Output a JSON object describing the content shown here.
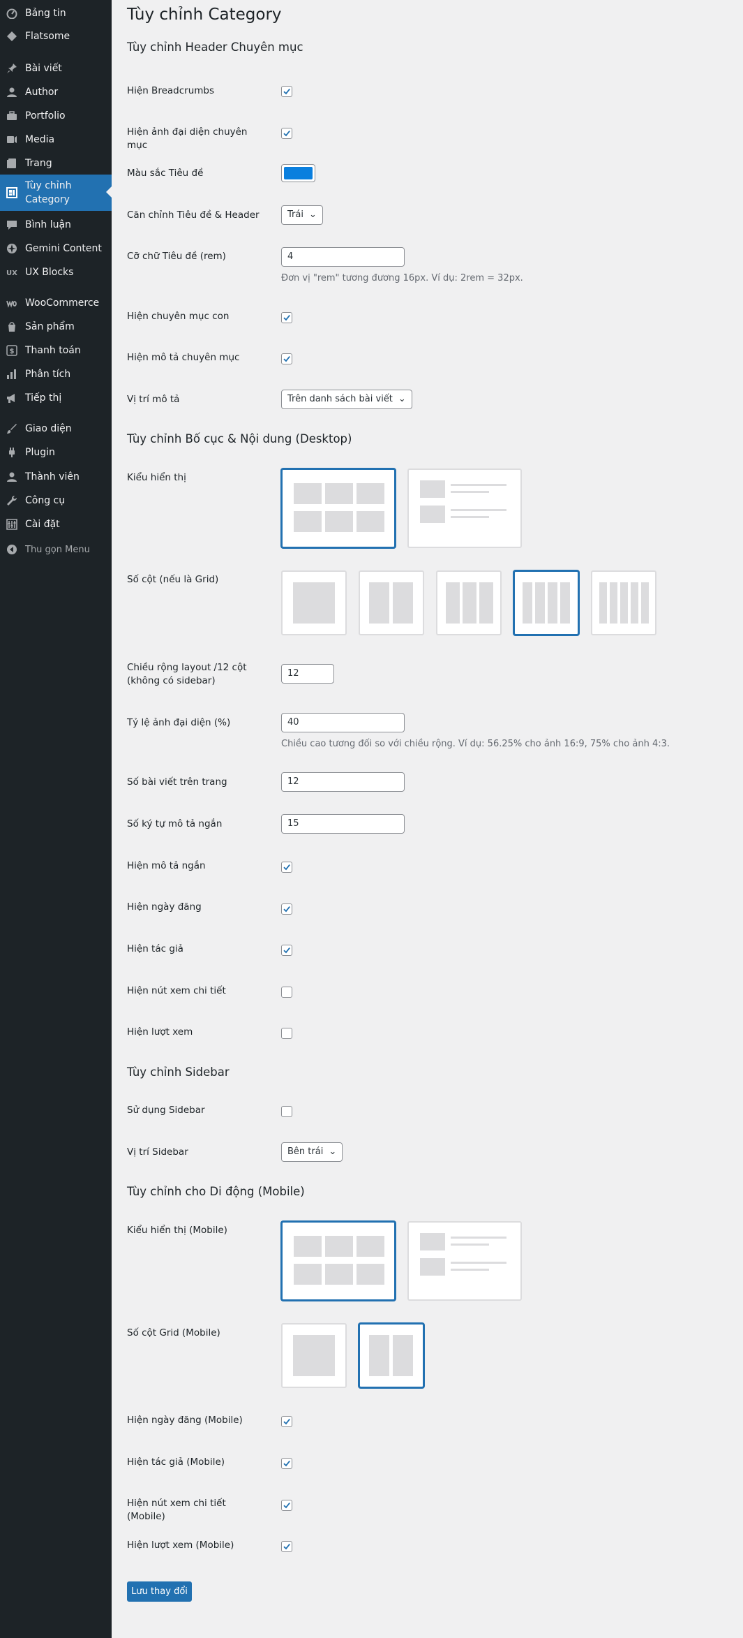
{
  "menu": [
    {
      "label": "Bảng tin",
      "icon": "dashboard-icon"
    },
    {
      "label": "Flatsome",
      "icon": "flatsome-icon"
    },
    {
      "label": "Bài viết",
      "icon": "pin-icon"
    },
    {
      "label": "Author",
      "icon": "user-icon"
    },
    {
      "label": "Portfolio",
      "icon": "portfolio-icon"
    },
    {
      "label": "Media",
      "icon": "media-icon"
    },
    {
      "label": "Trang",
      "icon": "page-icon"
    },
    {
      "label": "Tùy chỉnh Category",
      "icon": "layout-icon"
    },
    {
      "label": "Bình luận",
      "icon": "comment-icon"
    },
    {
      "label": "Gemini Content",
      "icon": "gemini-icon"
    },
    {
      "label": "UX Blocks",
      "icon": "blocks-icon"
    },
    {
      "label": "WooCommerce",
      "icon": "woo-icon"
    },
    {
      "label": "Sản phẩm",
      "icon": "product-icon"
    },
    {
      "label": "Thanh toán",
      "icon": "payment-icon"
    },
    {
      "label": "Phân tích",
      "icon": "analytics-icon"
    },
    {
      "label": "Tiếp thị",
      "icon": "marketing-icon"
    },
    {
      "label": "Giao diện",
      "icon": "appearance-icon"
    },
    {
      "label": "Plugin",
      "icon": "plugin-icon"
    },
    {
      "label": "Thành viên",
      "icon": "users-icon"
    },
    {
      "label": "Công cụ",
      "icon": "tools-icon"
    },
    {
      "label": "Cài đặt",
      "icon": "settings-icon"
    },
    {
      "label": "Thu gọn Menu",
      "icon": "collapse-icon"
    }
  ],
  "page_title": "Tùy chỉnh Category",
  "sections": {
    "header": "Tùy chỉnh Header Chuyên mục",
    "layout": "Tùy chỉnh Bố cục & Nội dung (Desktop)",
    "sidebar": "Tùy chỉnh Sidebar",
    "mobile": "Tùy chỉnh cho Di động (Mobile)"
  },
  "fields": {
    "show_breadcrumbs": {
      "label": "Hiện Breadcrumbs",
      "checked": true
    },
    "show_cat_image": {
      "label": "Hiện ảnh đại diện chuyên mục",
      "checked": true
    },
    "title_color": {
      "label": "Màu sắc Tiêu đề",
      "color": "#0a7fde"
    },
    "title_align": {
      "label": "Căn chỉnh Tiêu đề & Header",
      "value": "Trái"
    },
    "title_size": {
      "label": "Cỡ chữ Tiêu đề (rem)",
      "value": "4",
      "desc": "Đơn vị \"rem\" tương đương 16px. Ví dụ: 2rem = 32px."
    },
    "show_subcats": {
      "label": "Hiện chuyên mục con",
      "checked": true
    },
    "show_cat_desc": {
      "label": "Hiện mô tả chuyên mục",
      "checked": true
    },
    "desc_position": {
      "label": "Vị trí mô tả",
      "value": "Trên danh sách bài viết"
    },
    "display_style": {
      "label": "Kiểu hiển thị"
    },
    "columns": {
      "label": "Số cột (nếu là Grid)"
    },
    "layout_width": {
      "label": "Chiều rộng layout /12 cột (không có sidebar)",
      "value": "12"
    },
    "image_ratio": {
      "label": "Tỷ lệ ảnh đại diện (%)",
      "value": "40",
      "desc": "Chiều cao tương đối so với chiều rộng. Ví dụ: 56.25% cho ảnh 16:9, 75% cho ảnh 4:3."
    },
    "posts_per_page": {
      "label": "Số bài viết trên trang",
      "value": "12"
    },
    "excerpt_length": {
      "label": "Số ký tự mô tả ngắn",
      "value": "15"
    },
    "show_excerpt": {
      "label": "Hiện mô tả ngắn",
      "checked": true
    },
    "show_date": {
      "label": "Hiện ngày đăng",
      "checked": true
    },
    "show_author": {
      "label": "Hiện tác giả",
      "checked": true
    },
    "show_readmore": {
      "label": "Hiện nút xem chi tiết",
      "checked": false
    },
    "show_views": {
      "label": "Hiện lượt xem",
      "checked": false
    },
    "use_sidebar": {
      "label": "Sử dụng Sidebar",
      "checked": false
    },
    "sidebar_position": {
      "label": "Vị trí Sidebar",
      "value": "Bên trái"
    },
    "m_display_style": {
      "label": "Kiểu hiển thị (Mobile)"
    },
    "m_columns": {
      "label": "Số cột Grid (Mobile)"
    },
    "m_show_date": {
      "label": "Hiện ngày đăng (Mobile)",
      "checked": true
    },
    "m_show_author": {
      "label": "Hiện tác giả (Mobile)",
      "checked": true
    },
    "m_show_readmore": {
      "label": "Hiện nút xem chi tiết (Mobile)",
      "checked": true
    },
    "m_show_views": {
      "label": "Hiện lượt xem (Mobile)",
      "checked": true
    }
  },
  "save_label": "Lưu thay đổi",
  "colors": {
    "accent": "#2271b1",
    "sidebar_bg": "#1d2327",
    "page_bg": "#f0f0f1"
  }
}
